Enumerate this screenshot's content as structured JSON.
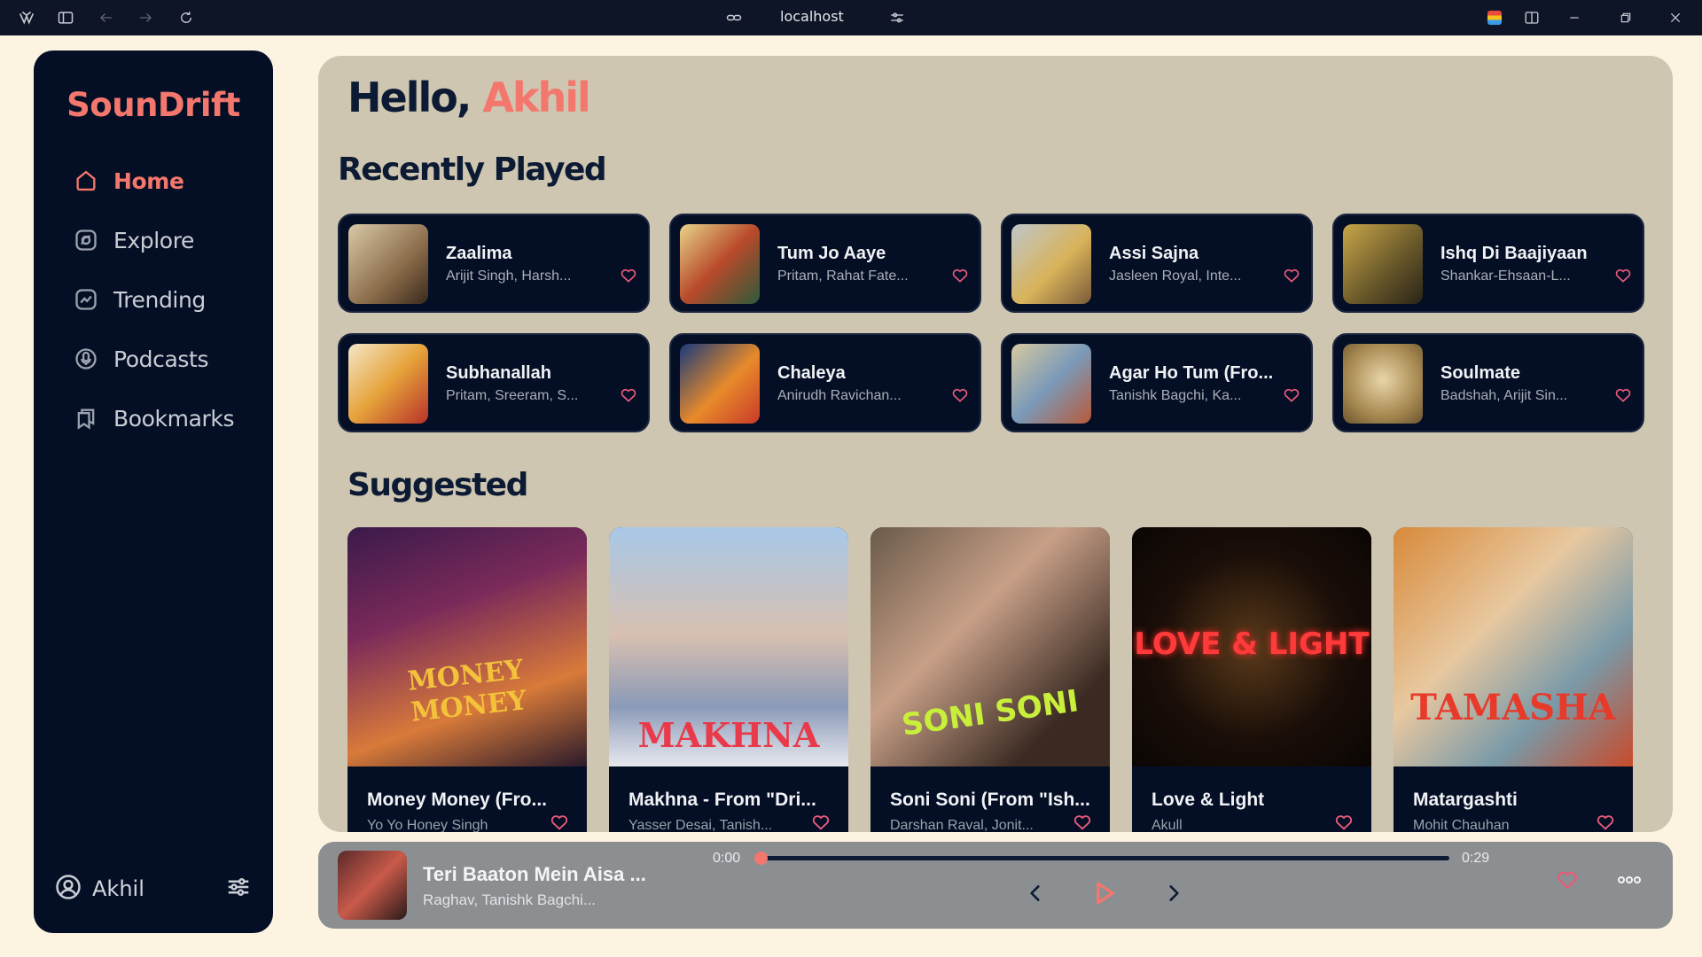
{
  "browser": {
    "url": "localhost"
  },
  "app": {
    "logo": "SounDrift"
  },
  "sidebar": {
    "items": [
      {
        "label": "Home",
        "icon": "home-icon",
        "active": true
      },
      {
        "label": "Explore",
        "icon": "compass-icon",
        "active": false
      },
      {
        "label": "Trending",
        "icon": "trending-icon",
        "active": false
      },
      {
        "label": "Podcasts",
        "icon": "microphone-icon",
        "active": false
      },
      {
        "label": "Bookmarks",
        "icon": "bookmark-icon",
        "active": false
      }
    ],
    "user": {
      "name": "Akhil"
    }
  },
  "main": {
    "greeting_prefix": "Hello, ",
    "greeting_name": "Akhil",
    "recent_title": "Recently Played",
    "recent": [
      {
        "title": "Zaalima",
        "artists": "Arijit Singh, Harsh..."
      },
      {
        "title": "Tum Jo Aaye",
        "artists": "Pritam, Rahat Fate..."
      },
      {
        "title": "Assi Sajna",
        "artists": "Jasleen Royal, Inte..."
      },
      {
        "title": "Ishq Di Baajiyaan",
        "artists": "Shankar-Ehsaan-L..."
      },
      {
        "title": "Subhanallah",
        "artists": "Pritam, Sreeram, S..."
      },
      {
        "title": "Chaleya",
        "artists": "Anirudh Ravichan..."
      },
      {
        "title": "Agar Ho Tum (Fro...",
        "artists": "Tanishk Bagchi, Ka..."
      },
      {
        "title": "Soulmate",
        "artists": "Badshah, Arijit Sin..."
      }
    ],
    "suggested_title": "Suggested",
    "suggested": [
      {
        "title": "Money Money (Fro...",
        "artists": "Yo Yo Honey Singh",
        "art_text": "MONEY MONEY"
      },
      {
        "title": "Makhna - From \"Dri...",
        "artists": "Yasser Desai, Tanish...",
        "art_text": "MAKHNA"
      },
      {
        "title": "Soni Soni (From \"Ish...",
        "artists": "Darshan Raval, Jonit...",
        "art_text": "SONI SONI"
      },
      {
        "title": "Love & Light",
        "artists": "Akull",
        "art_text": "LOVE & LIGHT"
      },
      {
        "title": "Matargashti",
        "artists": "Mohit Chauhan",
        "art_text": "TAMASHA"
      }
    ]
  },
  "player": {
    "title": "Teri Baaton Mein Aisa ...",
    "artists": "Raghav, Tanishk Bagchi...",
    "current_time": "0:00",
    "duration": "0:29",
    "progress": 0.006
  },
  "colors": {
    "accent": "#f3776d",
    "sidebar": "#040f25",
    "main_bg": "#cfc6b1",
    "player_bg": "#8b8f92"
  }
}
